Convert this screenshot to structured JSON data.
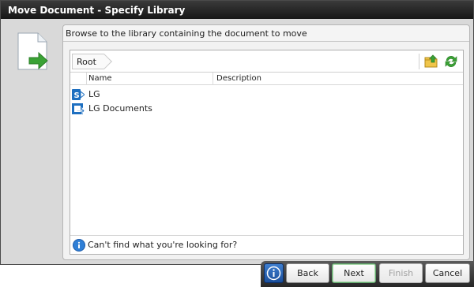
{
  "window": {
    "title": "Move Document - Specify Library"
  },
  "instruction": "Browse to the library containing the document to move",
  "browser": {
    "breadcrumb": "Root",
    "toolbar_icons": [
      "up-folder-icon",
      "refresh-icon"
    ],
    "columns": [
      "Name",
      "Description"
    ],
    "items": [
      {
        "name": "LG",
        "icon": "sharepoint-site-icon"
      },
      {
        "name": "LG Documents",
        "icon": "document-library-icon"
      }
    ],
    "help_text": "Can't find what you're looking for?"
  },
  "footer": {
    "back": "Back",
    "next": "Next",
    "finish": "Finish",
    "cancel": "Cancel"
  },
  "colors": {
    "titlebar": "#1f1f1f",
    "accent_green": "#3aa235",
    "accent_blue": "#1e6fc0"
  }
}
